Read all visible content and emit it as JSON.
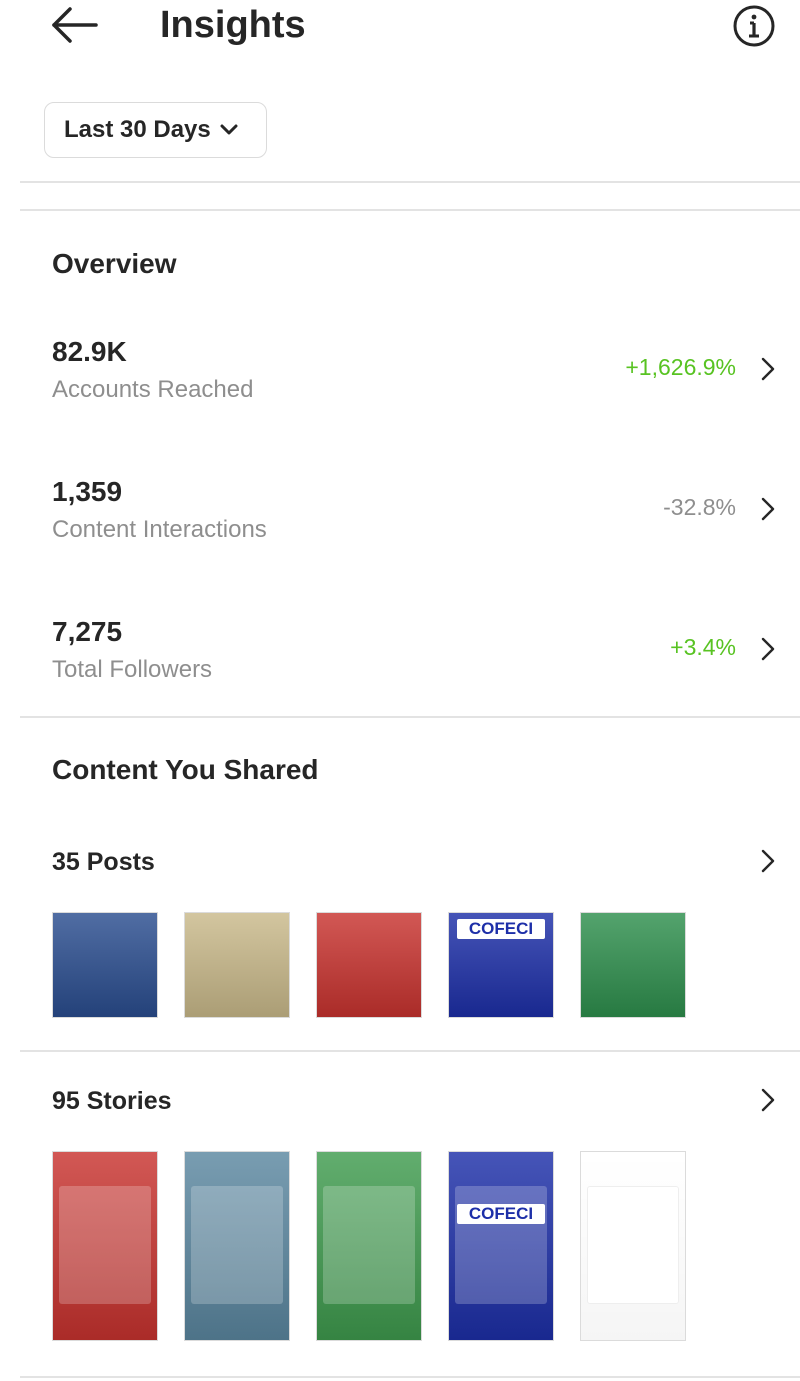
{
  "header": {
    "title": "Insights",
    "back_icon": "arrow-left-icon",
    "info_icon": "info-circle-icon"
  },
  "date_range": {
    "label": "Last 30 Days",
    "icon": "chevron-down-icon"
  },
  "overview": {
    "title": "Overview",
    "metrics": [
      {
        "value": "82.9K",
        "label": "Accounts Reached",
        "delta": "+1,626.9%",
        "trend": "up"
      },
      {
        "value": "1,359",
        "label": "Content Interactions",
        "delta": "-32.8%",
        "trend": "down"
      },
      {
        "value": "7,275",
        "label": "Total Followers",
        "delta": "+3.4%",
        "trend": "up"
      }
    ]
  },
  "content_shared": {
    "title": "Content You Shared",
    "posts": {
      "label": "35 Posts",
      "thumbnails": [
        {
          "name": "post-thumb-1",
          "bg": "#2a4d8f"
        },
        {
          "name": "post-thumb-2",
          "bg": "#c9b98a"
        },
        {
          "name": "post-thumb-3",
          "bg": "#c8332f"
        },
        {
          "name": "post-thumb-4",
          "bg": "#1d2fa8",
          "brand": "COFECI"
        },
        {
          "name": "post-thumb-5",
          "bg": "#2e8f4d"
        }
      ]
    },
    "stories": {
      "label": "95 Stories",
      "thumbnails": [
        {
          "name": "story-thumb-1",
          "bg": "#c8332f"
        },
        {
          "name": "story-thumb-2",
          "bg": "#5b87a0"
        },
        {
          "name": "story-thumb-3",
          "bg": "#3f9b4e"
        },
        {
          "name": "story-thumb-4",
          "bg": "#1d2fa8",
          "brand": "COFECI"
        },
        {
          "name": "story-thumb-5",
          "bg": "#ffffff"
        }
      ]
    }
  },
  "colors": {
    "positive": "#58c322",
    "neutral": "#8e8e8e",
    "text": "#262626",
    "divider": "#e3e3e3"
  }
}
